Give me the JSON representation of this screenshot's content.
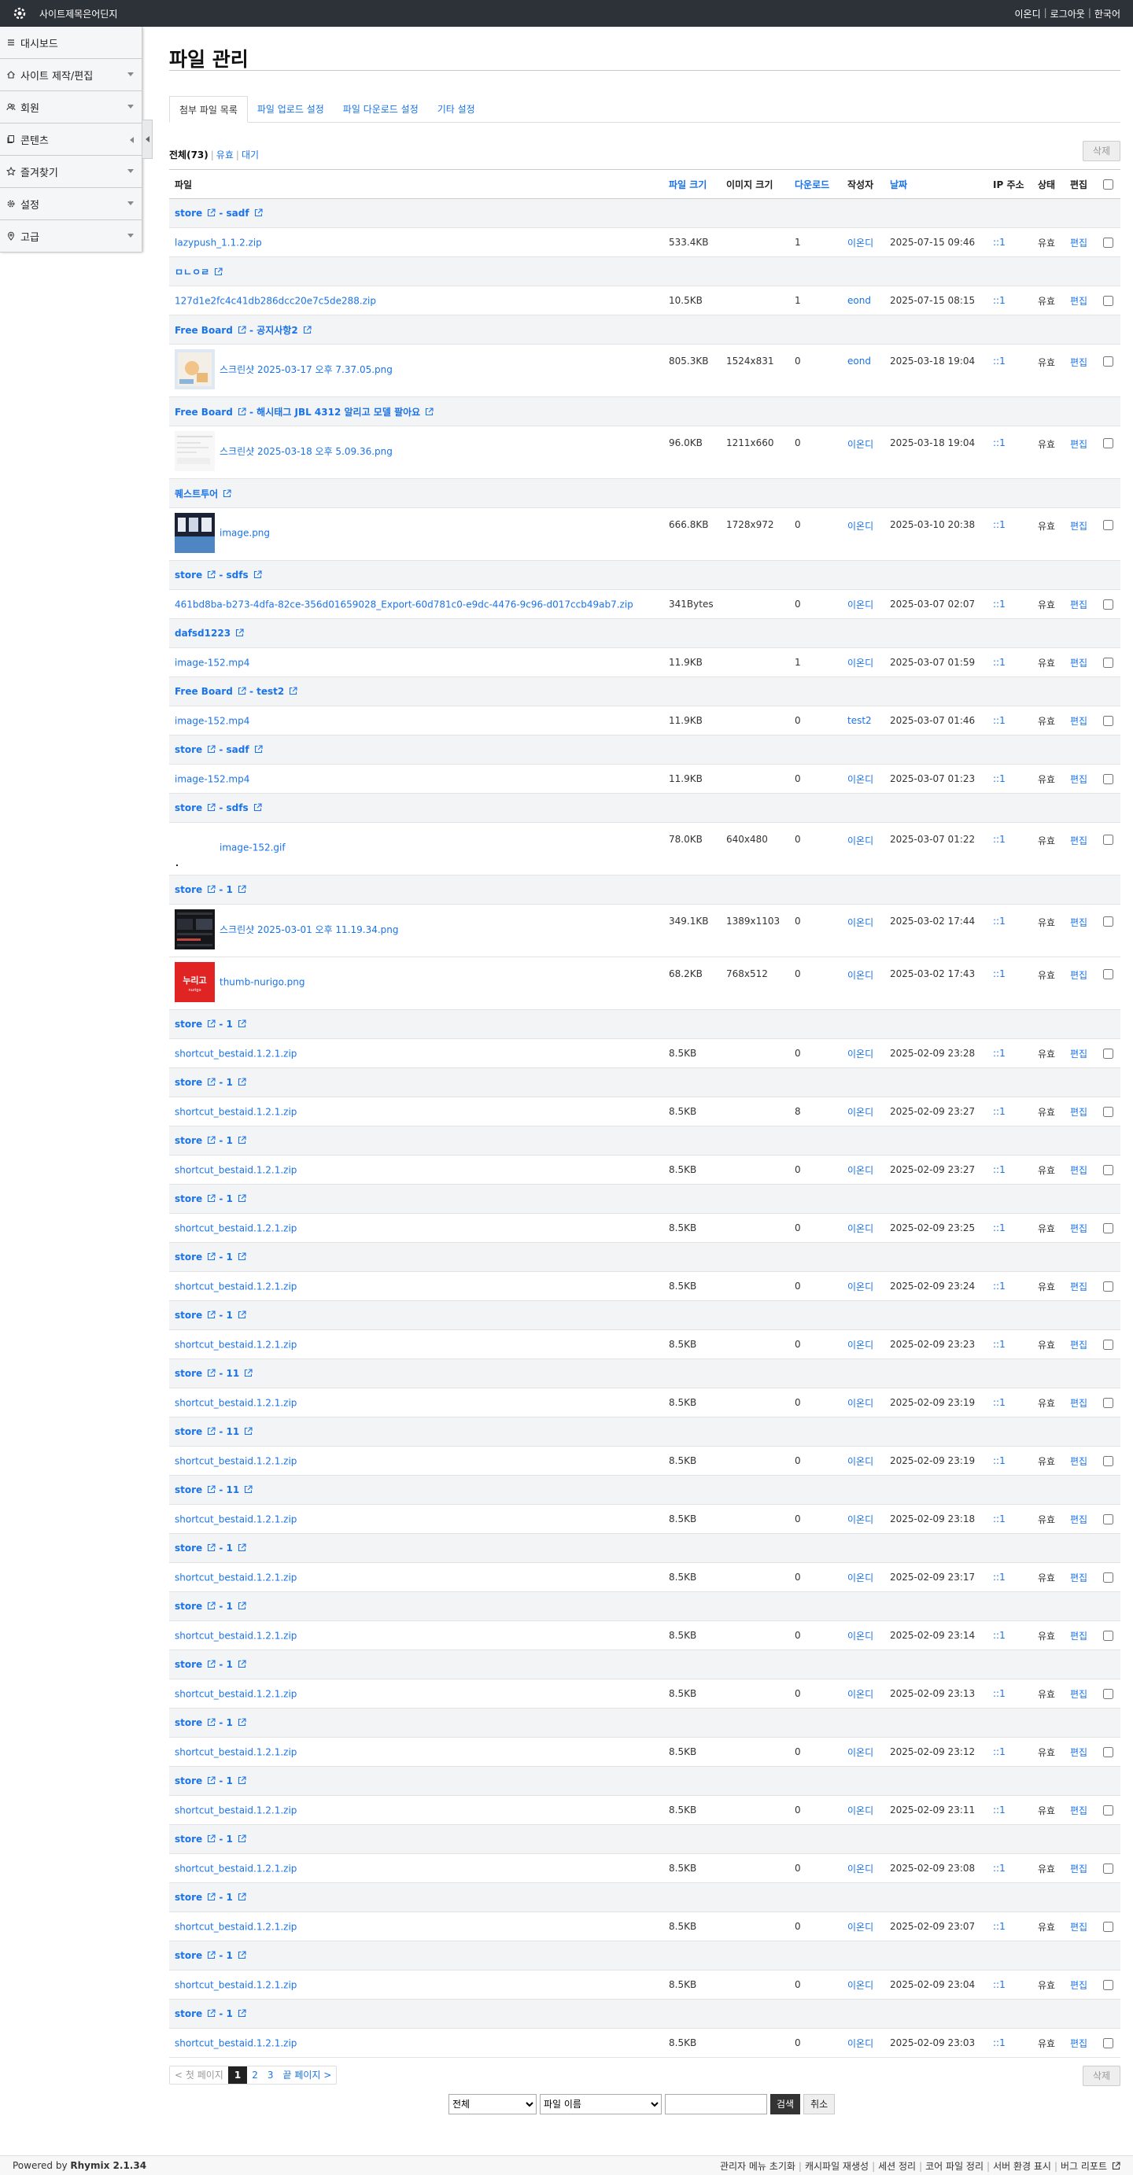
{
  "app": {
    "site_name": "사이트제목은어딘지"
  },
  "toplinks": {
    "user": "이온디",
    "logout": "로그아웃",
    "lang": "한국어"
  },
  "sidebar": {
    "items": [
      {
        "label": "대시보드",
        "icon": "menu-icon",
        "caret": false,
        "open": false
      },
      {
        "label": "사이트 제작/편집",
        "icon": "home-icon",
        "caret": true,
        "open": false
      },
      {
        "label": "회원",
        "icon": "users-icon",
        "caret": true,
        "open": false
      },
      {
        "label": "콘텐츠",
        "icon": "files-icon",
        "caret": true,
        "open": true
      },
      {
        "label": "즐겨찾기",
        "icon": "star-icon",
        "caret": true,
        "open": false
      },
      {
        "label": "설정",
        "icon": "gear-icon",
        "caret": true,
        "open": false
      },
      {
        "label": "고급",
        "icon": "pin-icon",
        "caret": true,
        "open": false
      }
    ]
  },
  "page": {
    "title": "파일 관리"
  },
  "tabs": [
    "첨부 파일 목록",
    "파일 업로드 설정",
    "파일 다운로드 설정",
    "기타 설정"
  ],
  "filters": {
    "all": "전체(73)",
    "valid": "유효",
    "waiting": "대기"
  },
  "actions": {
    "delete": "삭제"
  },
  "columns": {
    "file": "파일",
    "size": "파일 크기",
    "img": "이미지 크기",
    "dl": "다운로드",
    "author": "작성자",
    "date": "날짜",
    "ip": "IP 주소",
    "status": "상태",
    "edit": "편집"
  },
  "groups": [
    {
      "title": "store",
      "sub": "- sadf",
      "files": [
        {
          "name": "lazypush_1.1.2.zip",
          "size": "533.4KB",
          "img": "",
          "dl": "1",
          "author": "이온디",
          "date": "2025-07-15 09:46",
          "ip": "::1",
          "status": "유효",
          "edit": "편집",
          "thumb": ""
        }
      ]
    },
    {
      "title": "ㅁㄴㅇㄹ",
      "sub": "",
      "files": [
        {
          "name": "127d1e2fc4c41db286dcc20e7c5de288.zip",
          "size": "10.5KB",
          "img": "",
          "dl": "1",
          "author": "eond",
          "date": "2025-07-15 08:15",
          "ip": "::1",
          "status": "유효",
          "edit": "편집",
          "thumb": ""
        }
      ]
    },
    {
      "title": "Free Board",
      "sub": "- 공지사항2",
      "files": [
        {
          "name": "스크린샷 2025-03-17 오후 7.37.05.png",
          "size": "805.3KB",
          "img": "1524x831",
          "dl": "0",
          "author": "eond",
          "date": "2025-03-18 19:04",
          "ip": "::1",
          "status": "유효",
          "edit": "편집",
          "thumb": "illustration"
        }
      ]
    },
    {
      "title": "Free Board",
      "sub": "- 해시태그 JBL 4312 알리고 모델 팔아요",
      "files": [
        {
          "name": "스크린샷 2025-03-18 오후 5.09.36.png",
          "size": "96.0KB",
          "img": "1211x660",
          "dl": "0",
          "author": "이온디",
          "date": "2025-03-18 19:04",
          "ip": "::1",
          "status": "유효",
          "edit": "편집",
          "thumb": "light-page"
        }
      ]
    },
    {
      "title": "퀘스트투어",
      "sub": "",
      "files": [
        {
          "name": "image.png",
          "size": "666.8KB",
          "img": "1728x972",
          "dl": "0",
          "author": "이온디",
          "date": "2025-03-10 20:38",
          "ip": "::1",
          "status": "유효",
          "edit": "편집",
          "thumb": "dark-blue"
        }
      ]
    },
    {
      "title": "store",
      "sub": "- sdfs",
      "files": [
        {
          "name": "461bd8ba-b273-4dfa-82ce-356d01659028_Export-60d781c0-e9dc-4476-9c96-d017ccb49ab7.zip",
          "size": "341Bytes",
          "img": "",
          "dl": "0",
          "author": "이온디",
          "date": "2025-03-07 02:07",
          "ip": "::1",
          "status": "유효",
          "edit": "편집",
          "thumb": ""
        }
      ]
    },
    {
      "title": "dafsd1223",
      "sub": "",
      "files": [
        {
          "name": "image-152.mp4",
          "size": "11.9KB",
          "img": "",
          "dl": "1",
          "author": "이온디",
          "date": "2025-03-07 01:59",
          "ip": "::1",
          "status": "유효",
          "edit": "편집",
          "thumb": ""
        }
      ]
    },
    {
      "title": "Free Board",
      "sub": "- test2",
      "files": [
        {
          "name": "image-152.mp4",
          "size": "11.9KB",
          "img": "",
          "dl": "0",
          "author": "test2",
          "date": "2025-03-07 01:46",
          "ip": "::1",
          "status": "유효",
          "edit": "편집",
          "thumb": ""
        }
      ]
    },
    {
      "title": "store",
      "sub": "- sadf",
      "files": [
        {
          "name": "image-152.mp4",
          "size": "11.9KB",
          "img": "",
          "dl": "0",
          "author": "이온디",
          "date": "2025-03-07 01:23",
          "ip": "::1",
          "status": "유효",
          "edit": "편집",
          "thumb": ""
        }
      ]
    },
    {
      "title": "store",
      "sub": "- sdfs",
      "files": [
        {
          "name": "image-152.gif",
          "size": "78.0KB",
          "img": "640x480",
          "dl": "0",
          "author": "이온디",
          "date": "2025-03-07 01:22",
          "ip": "::1",
          "status": "유효",
          "edit": "편집",
          "thumb": "blank"
        }
      ]
    },
    {
      "title": "store",
      "sub": "- 1",
      "files": [
        {
          "name": "스크린샷 2025-03-01 오후 11.19.34.png",
          "size": "349.1KB",
          "img": "1389x1103",
          "dl": "0",
          "author": "이온디",
          "date": "2025-03-02 17:44",
          "ip": "::1",
          "status": "유효",
          "edit": "편집",
          "thumb": "dark-ui"
        },
        {
          "name": "thumb-nurigo.png",
          "size": "68.2KB",
          "img": "768x512",
          "dl": "0",
          "author": "이온디",
          "date": "2025-03-02 17:43",
          "ip": "::1",
          "status": "유효",
          "edit": "편집",
          "thumb": "red-logo"
        }
      ]
    },
    {
      "title": "store",
      "sub": "- 1",
      "files": [
        {
          "name": "shortcut_bestaid.1.2.1.zip",
          "size": "8.5KB",
          "img": "",
          "dl": "0",
          "author": "이온디",
          "date": "2025-02-09 23:28",
          "ip": "::1",
          "status": "유효",
          "edit": "편집",
          "thumb": ""
        }
      ]
    },
    {
      "title": "store",
      "sub": "- 1",
      "files": [
        {
          "name": "shortcut_bestaid.1.2.1.zip",
          "size": "8.5KB",
          "img": "",
          "dl": "8",
          "author": "이온디",
          "date": "2025-02-09 23:27",
          "ip": "::1",
          "status": "유효",
          "edit": "편집",
          "thumb": ""
        }
      ]
    },
    {
      "title": "store",
      "sub": "- 1",
      "files": [
        {
          "name": "shortcut_bestaid.1.2.1.zip",
          "size": "8.5KB",
          "img": "",
          "dl": "0",
          "author": "이온디",
          "date": "2025-02-09 23:27",
          "ip": "::1",
          "status": "유효",
          "edit": "편집",
          "thumb": ""
        }
      ]
    },
    {
      "title": "store",
      "sub": "- 1",
      "files": [
        {
          "name": "shortcut_bestaid.1.2.1.zip",
          "size": "8.5KB",
          "img": "",
          "dl": "0",
          "author": "이온디",
          "date": "2025-02-09 23:25",
          "ip": "::1",
          "status": "유효",
          "edit": "편집",
          "thumb": ""
        }
      ]
    },
    {
      "title": "store",
      "sub": "- 1",
      "files": [
        {
          "name": "shortcut_bestaid.1.2.1.zip",
          "size": "8.5KB",
          "img": "",
          "dl": "0",
          "author": "이온디",
          "date": "2025-02-09 23:24",
          "ip": "::1",
          "status": "유효",
          "edit": "편집",
          "thumb": ""
        }
      ]
    },
    {
      "title": "store",
      "sub": "- 1",
      "files": [
        {
          "name": "shortcut_bestaid.1.2.1.zip",
          "size": "8.5KB",
          "img": "",
          "dl": "0",
          "author": "이온디",
          "date": "2025-02-09 23:23",
          "ip": "::1",
          "status": "유효",
          "edit": "편집",
          "thumb": ""
        }
      ]
    },
    {
      "title": "store",
      "sub": "- 11",
      "files": [
        {
          "name": "shortcut_bestaid.1.2.1.zip",
          "size": "8.5KB",
          "img": "",
          "dl": "0",
          "author": "이온디",
          "date": "2025-02-09 23:19",
          "ip": "::1",
          "status": "유효",
          "edit": "편집",
          "thumb": ""
        }
      ]
    },
    {
      "title": "store",
      "sub": "- 11",
      "files": [
        {
          "name": "shortcut_bestaid.1.2.1.zip",
          "size": "8.5KB",
          "img": "",
          "dl": "0",
          "author": "이온디",
          "date": "2025-02-09 23:19",
          "ip": "::1",
          "status": "유효",
          "edit": "편집",
          "thumb": ""
        }
      ]
    },
    {
      "title": "store",
      "sub": "- 11",
      "files": [
        {
          "name": "shortcut_bestaid.1.2.1.zip",
          "size": "8.5KB",
          "img": "",
          "dl": "0",
          "author": "이온디",
          "date": "2025-02-09 23:18",
          "ip": "::1",
          "status": "유효",
          "edit": "편집",
          "thumb": ""
        }
      ]
    },
    {
      "title": "store",
      "sub": "- 1",
      "files": [
        {
          "name": "shortcut_bestaid.1.2.1.zip",
          "size": "8.5KB",
          "img": "",
          "dl": "0",
          "author": "이온디",
          "date": "2025-02-09 23:17",
          "ip": "::1",
          "status": "유효",
          "edit": "편집",
          "thumb": ""
        }
      ]
    },
    {
      "title": "store",
      "sub": "- 1",
      "files": [
        {
          "name": "shortcut_bestaid.1.2.1.zip",
          "size": "8.5KB",
          "img": "",
          "dl": "0",
          "author": "이온디",
          "date": "2025-02-09 23:14",
          "ip": "::1",
          "status": "유효",
          "edit": "편집",
          "thumb": ""
        }
      ]
    },
    {
      "title": "store",
      "sub": "- 1",
      "files": [
        {
          "name": "shortcut_bestaid.1.2.1.zip",
          "size": "8.5KB",
          "img": "",
          "dl": "0",
          "author": "이온디",
          "date": "2025-02-09 23:13",
          "ip": "::1",
          "status": "유효",
          "edit": "편집",
          "thumb": ""
        }
      ]
    },
    {
      "title": "store",
      "sub": "- 1",
      "files": [
        {
          "name": "shortcut_bestaid.1.2.1.zip",
          "size": "8.5KB",
          "img": "",
          "dl": "0",
          "author": "이온디",
          "date": "2025-02-09 23:12",
          "ip": "::1",
          "status": "유효",
          "edit": "편집",
          "thumb": ""
        }
      ]
    },
    {
      "title": "store",
      "sub": "- 1",
      "files": [
        {
          "name": "shortcut_bestaid.1.2.1.zip",
          "size": "8.5KB",
          "img": "",
          "dl": "0",
          "author": "이온디",
          "date": "2025-02-09 23:11",
          "ip": "::1",
          "status": "유효",
          "edit": "편집",
          "thumb": ""
        }
      ]
    },
    {
      "title": "store",
      "sub": "- 1",
      "files": [
        {
          "name": "shortcut_bestaid.1.2.1.zip",
          "size": "8.5KB",
          "img": "",
          "dl": "0",
          "author": "이온디",
          "date": "2025-02-09 23:08",
          "ip": "::1",
          "status": "유효",
          "edit": "편집",
          "thumb": ""
        }
      ]
    },
    {
      "title": "store",
      "sub": "- 1",
      "files": [
        {
          "name": "shortcut_bestaid.1.2.1.zip",
          "size": "8.5KB",
          "img": "",
          "dl": "0",
          "author": "이온디",
          "date": "2025-02-09 23:07",
          "ip": "::1",
          "status": "유효",
          "edit": "편집",
          "thumb": ""
        }
      ]
    },
    {
      "title": "store",
      "sub": "- 1",
      "files": [
        {
          "name": "shortcut_bestaid.1.2.1.zip",
          "size": "8.5KB",
          "img": "",
          "dl": "0",
          "author": "이온디",
          "date": "2025-02-09 23:04",
          "ip": "::1",
          "status": "유효",
          "edit": "편집",
          "thumb": ""
        }
      ]
    },
    {
      "title": "store",
      "sub": "- 1",
      "files": [
        {
          "name": "shortcut_bestaid.1.2.1.zip",
          "size": "8.5KB",
          "img": "",
          "dl": "0",
          "author": "이온디",
          "date": "2025-02-09 23:03",
          "ip": "::1",
          "status": "유효",
          "edit": "편집",
          "thumb": ""
        }
      ]
    }
  ],
  "pagination": {
    "first": "< 첫 페이지",
    "pages": [
      "1",
      "2",
      "3"
    ],
    "current": "1",
    "last": "끝 페이지 >"
  },
  "search": {
    "scope_options": [
      "전체"
    ],
    "scope": "전체",
    "target_options": [
      "파일 이름"
    ],
    "target": "파일 이름",
    "query": "",
    "submit": "검색",
    "cancel": "취소"
  },
  "footer": {
    "powered_prefix": "Powered by",
    "powered_name": "Rhymix 2.1.34",
    "links": [
      "관리자 메뉴 초기화",
      "캐시파일 재생성",
      "세션 정리",
      "코어 파일 정리",
      "서버 환경 표시",
      "버그 리포트"
    ]
  },
  "colors": {
    "topbar": "#2d3238",
    "link": "#1a73e8",
    "group_bg": "#f3f4f5"
  }
}
